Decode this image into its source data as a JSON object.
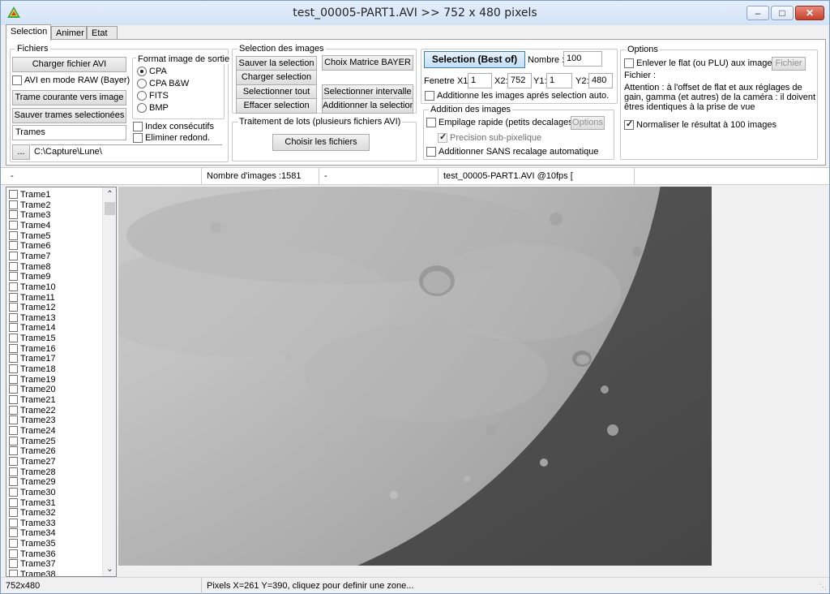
{
  "window": {
    "title": "test_00005-PART1.AVI >>  752 x 480 pixels"
  },
  "tabs": [
    "Selection",
    "Animer",
    "Etat"
  ],
  "fichiers": {
    "group": "Fichiers",
    "load_button": "Charger fichier AVI",
    "raw_checkbox": "AVI en mode RAW (Bayer)",
    "current_to_image_button": "Trame courante vers image",
    "save_selected_button": "Sauver trames selectionées",
    "name_input": "Trames",
    "browse_button": "...",
    "path": "C:\\Capture\\Lune\\"
  },
  "format": {
    "label": "Format image de sortie",
    "options": [
      "CPA",
      "CPA B&W",
      "FITS",
      "BMP"
    ],
    "selected_index": 0,
    "index_consecutive": "Index consécutifs",
    "remove_redundant": "Eliminer redond."
  },
  "selection_images": {
    "group": "Selection des images",
    "save_selection": "Sauver la selection",
    "bayer_matrix": "Choix Matrice BAYER",
    "load_selection": "Charger selection",
    "select_all": "Selectionner tout",
    "select_interval": "Selectionner intervalle",
    "clear_selection": "Effacer selection",
    "add_selection": "Additionner la selection"
  },
  "batch": {
    "group": "Traitement de lots (plusieurs fichiers AVI)",
    "choose_files": "Choisir les fichiers"
  },
  "best_of": {
    "button": "Selection (Best of)",
    "nombre_label": "Nombre :",
    "nombre_value": "100",
    "fenetre_label": "Fenetre X1:",
    "x1": "1",
    "x2_label": "X2:",
    "x2": "752",
    "y1_label": "Y1:",
    "y1": "1",
    "y2_label": "Y2:",
    "y2": "480",
    "add_after_auto": "Additionne les images aprés selection auto."
  },
  "addition": {
    "group": "Addition des images",
    "fast_stack": "Empilage rapide (petits decalages)",
    "options_button": "Options",
    "subpixel": "Precision sub-pixelique",
    "no_registration": "Additionner SANS recalage automatique"
  },
  "options": {
    "group": "Options",
    "remove_flat": "Enlever le flat (ou PLU) aux images",
    "fichier_button": "Fichier",
    "fichier_label": "Fichier :",
    "attention": "Attention : à l'offset de flat et aux réglages de gain, gamma (et autres) de la caméra : il doivent êtres identiques à la prise de vue",
    "normalize": "Normaliser le résultat à 100 images"
  },
  "strip": {
    "c1": "-",
    "c2": "Nombre d'images :1581",
    "c3": "-",
    "c4": "test_00005-PART1.AVI @10fps ["
  },
  "frames": [
    "Trame1",
    "Trame2",
    "Trame3",
    "Trame4",
    "Trame5",
    "Trame6",
    "Trame7",
    "Trame8",
    "Trame9",
    "Trame10",
    "Trame11",
    "Trame12",
    "Trame13",
    "Trame14",
    "Trame15",
    "Trame16",
    "Trame17",
    "Trame18",
    "Trame19",
    "Trame20",
    "Trame21",
    "Trame22",
    "Trame23",
    "Trame24",
    "Trame25",
    "Trame26",
    "Trame27",
    "Trame28",
    "Trame29",
    "Trame30",
    "Trame31",
    "Trame32",
    "Trame33",
    "Trame34",
    "Trame35",
    "Trame36",
    "Trame37",
    "Trame38"
  ],
  "statusbar": {
    "size": "752x480",
    "pixels": "Pixels X=261 Y=390, cliquez pour definir une zone..."
  },
  "icons": [
    "app-logo-icon",
    "minimize-icon",
    "maximize-icon",
    "close-icon",
    "scroll-up-icon",
    "scroll-down-icon",
    "resize-grip-icon"
  ]
}
